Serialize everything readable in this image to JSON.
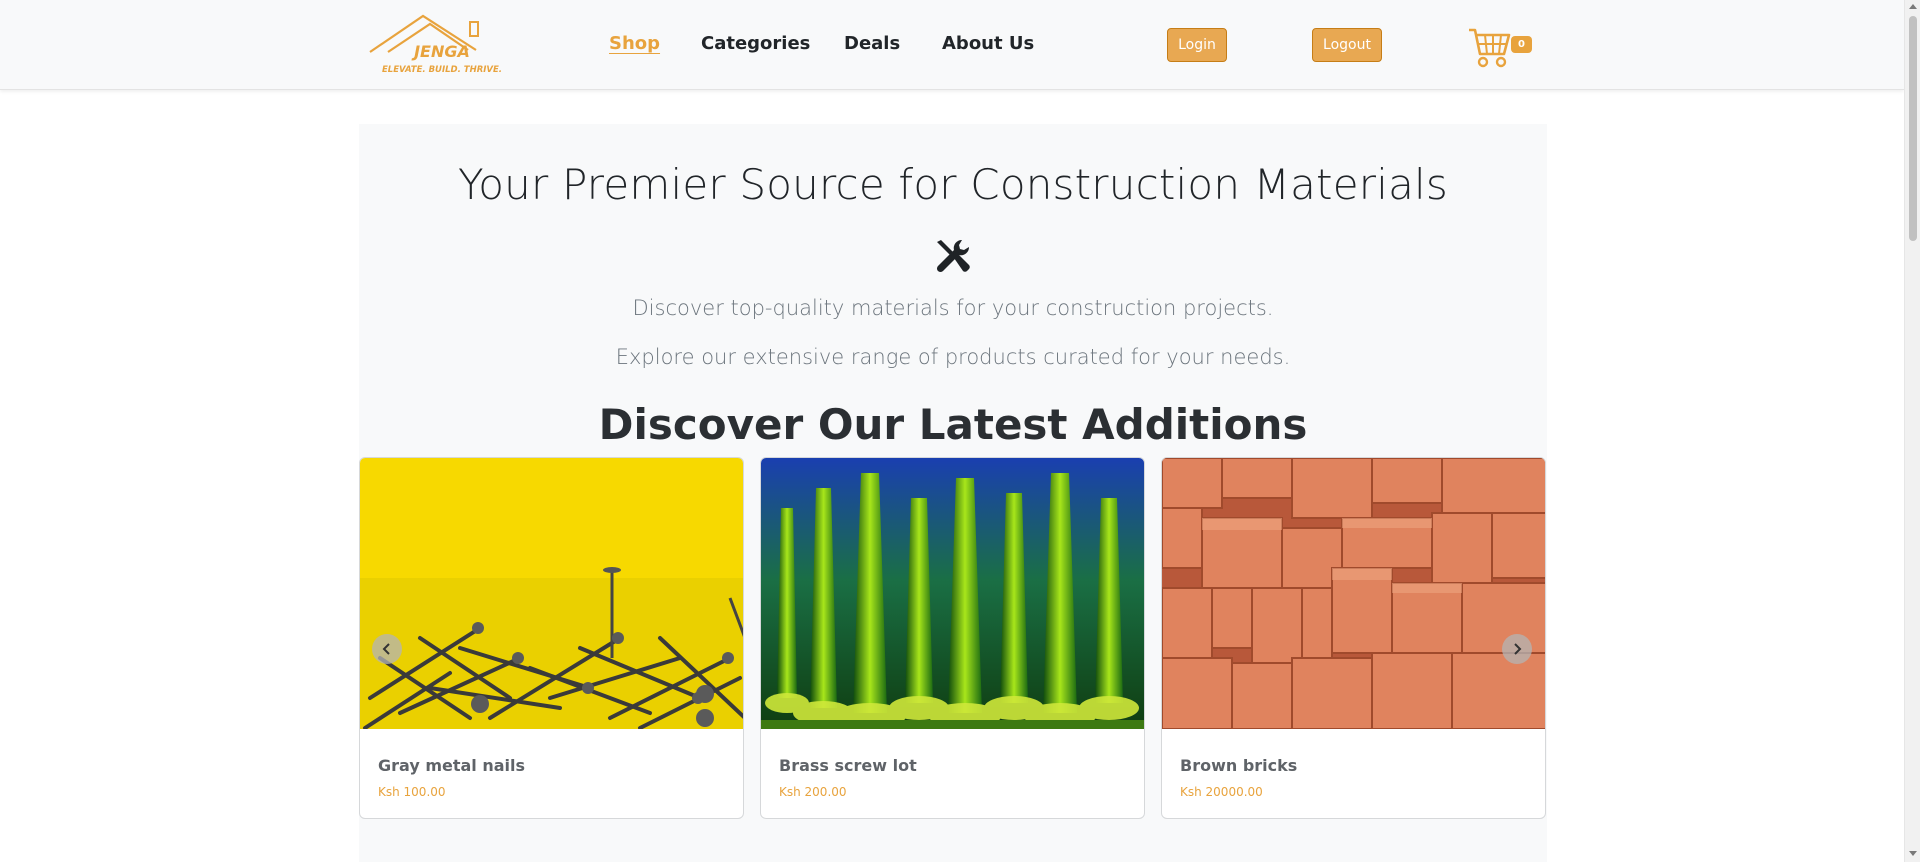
{
  "brand": {
    "name": "JENGA",
    "tagline": "ELEVATE. BUILD. THRIVE.",
    "color": "#e8a33d"
  },
  "nav": {
    "links": [
      {
        "label": "Shop",
        "active": true
      },
      {
        "label": "Categories",
        "active": false
      },
      {
        "label": "Deals",
        "active": false
      },
      {
        "label": "About Us",
        "active": false
      }
    ],
    "login_label": "Login",
    "logout_label": "Logout",
    "cart_count": "0"
  },
  "hero": {
    "title": "Your Premier Source for Construction Materials",
    "icon": "tools-icon",
    "lead_1": "Discover top-quality materials for your construction projects.",
    "lead_2": "Explore our extensive range of products curated for your needs."
  },
  "latest": {
    "title": "Discover Our Latest Additions",
    "products": [
      {
        "name": "Gray metal nails",
        "price": "Ksh 100.00"
      },
      {
        "name": "Brass screw lot",
        "price": "Ksh 200.00"
      },
      {
        "name": "Brown bricks",
        "price": "Ksh 20000.00"
      }
    ],
    "prev_icon": "chevron-left-icon",
    "next_icon": "chevron-right-icon"
  }
}
